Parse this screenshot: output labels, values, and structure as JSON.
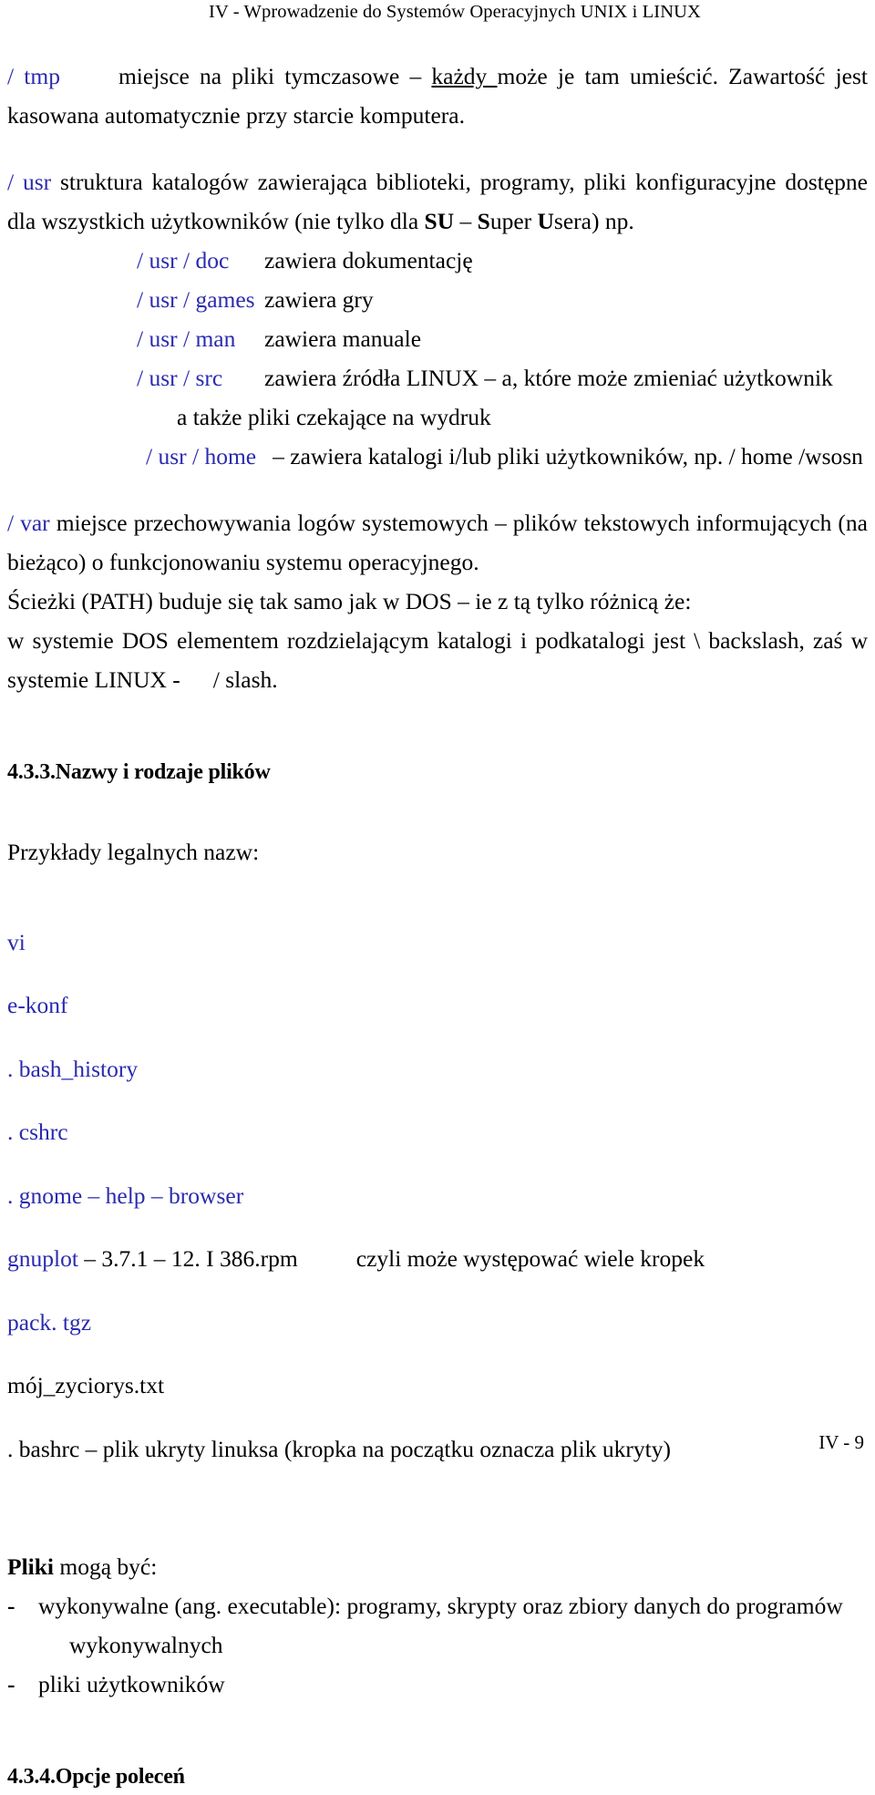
{
  "header": {
    "running_title": "IV -  Wprowadzenie do Systemów Operacyjnych UNIX i LINUX"
  },
  "footer": {
    "page_label": "IV - 9"
  },
  "content": {
    "tmp": {
      "path": "/ tmp",
      "text_before": "miejsce na pliki tymczasowe – ",
      "underlined": "każdy ",
      "text_after": "może je tam umieścić. Zawartość jest kasowana automatycznie przy starcie komputera."
    },
    "usr": {
      "path": "/ usr",
      "text_a": " struktura katalogów zawierająca biblioteki, programy, pliki konfiguracyjne dostępne dla wszystkich użytkowników (nie tylko dla ",
      "bold_su": "SU",
      "text_b": " – ",
      "bold_super": "S",
      "text_c": "uper ",
      "bold_u": "U",
      "text_d": "sera) np."
    },
    "usr_entries": [
      {
        "path": "/ usr / doc",
        "desc": "zawiera dokumentację"
      },
      {
        "path": "/ usr / games",
        "desc": "zawiera gry"
      },
      {
        "path": "/ usr / man",
        "desc": "zawiera manuale"
      },
      {
        "path": "/ usr / src",
        "desc": "zawiera źródła LINUX – a,  które może zmieniać użytkownik"
      }
    ],
    "src_continuation": "a także pliki  czekające na wydruk",
    "home_entry": {
      "path": "/ usr / home",
      "desc": "– zawiera katalogi i/lub pliki użytkowników, np. / home /wsosn"
    },
    "var": {
      "path": "/ var",
      "text": " miejsce przechowywania logów systemowych – plików tekstowych informujących (na bieżąco) o funkcjonowaniu systemu operacyjnego."
    },
    "paths_para": "Ścieżki (PATH) buduje się tak samo jak w DOS – ie z tą tylko różnicą że:",
    "dos_para_a": "w systemie DOS elementem rozdzielającym katalogi i podkatalogi jest  \\  backslash, zaś w systemie LINUX -",
    "dos_para_b": "/ slash.",
    "heading_names": "4.3.3.Nazwy i rodzaje  plików",
    "examples_intro": "Przykłady legalnych nazw:",
    "examples": [
      {
        "text": "vi",
        "color": "blue"
      },
      {
        "text": "e-konf",
        "color": "blue"
      },
      {
        "text": ". bash_history",
        "color": "blue"
      },
      {
        "text": ". cshrc",
        "color": "blue"
      },
      {
        "text": ". gnome – help – browser",
        "color": "blue"
      }
    ],
    "gnuplot_line": {
      "name": "gnuplot",
      "rest": " – 3.7.1 – 12. I 386.rpm",
      "comment": "czyli może występować wiele kropek"
    },
    "pack_line": "pack. tgz",
    "cv_line": "mój_zyciorys.txt",
    "bashrc_line": ". bashrc – plik ukryty linuksa (kropka na początku oznacza plik ukryty)",
    "files_can_be": {
      "bold": "Pliki",
      "rest": " mogą być:"
    },
    "file_types": [
      {
        "mark": "-",
        "text": "wykonywalne (ang. executable): programy, skrypty oraz  zbiory danych do programów",
        "cont": "wykonywalnych"
      },
      {
        "mark": "-",
        "text": "pliki użytkowników",
        "cont": ""
      }
    ],
    "heading_options": "4.3.4.Opcje poleceń"
  },
  "colors": {
    "accent_blue": "#2a2ab0",
    "text_black": "#000000",
    "page_background": "#ffffff"
  }
}
